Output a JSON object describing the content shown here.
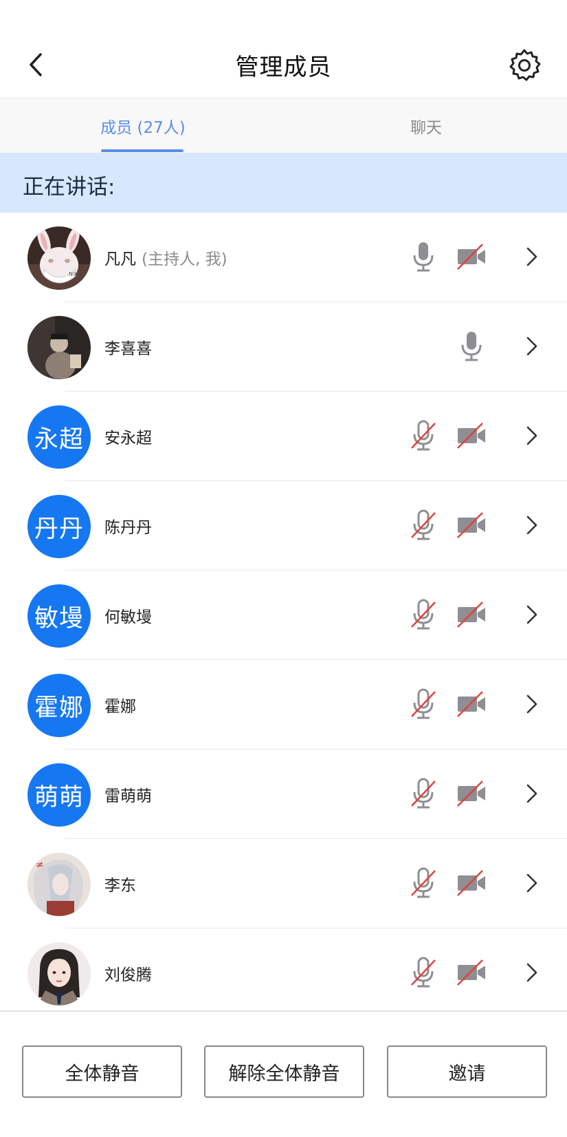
{
  "header": {
    "title": "管理成员",
    "back_icon": "chevron-left-icon",
    "settings_icon": "gear-icon"
  },
  "tabs": [
    {
      "label": "成员 (27人)",
      "selected": true
    },
    {
      "label": "聊天",
      "selected": false
    }
  ],
  "speaking_label": "正在讲话:",
  "members": [
    {
      "name": "凡凡",
      "role": "(主持人, 我)",
      "avatar": "photo-rabbit",
      "mic": "on",
      "camera": "off"
    },
    {
      "name": "李喜喜",
      "role": "",
      "avatar": "photo-dark",
      "mic": "on",
      "camera": "none"
    },
    {
      "name": "安永超",
      "role": "",
      "avatar_text": "永超",
      "mic": "off",
      "camera": "off"
    },
    {
      "name": "陈丹丹",
      "role": "",
      "avatar_text": "丹丹",
      "mic": "off",
      "camera": "off"
    },
    {
      "name": "何敏墁",
      "role": "",
      "avatar_text": "敏墁",
      "mic": "off",
      "camera": "off"
    },
    {
      "name": "霍娜",
      "role": "",
      "avatar_text": "霍娜",
      "mic": "off",
      "camera": "off"
    },
    {
      "name": "雷萌萌",
      "role": "",
      "avatar_text": "萌萌",
      "mic": "off",
      "camera": "off"
    },
    {
      "name": "李东",
      "role": "",
      "avatar": "photo-anime",
      "mic": "off",
      "camera": "off"
    },
    {
      "name": "刘俊腾",
      "role": "",
      "avatar": "photo-girl",
      "mic": "off",
      "camera": "off"
    }
  ],
  "buttons": {
    "mute_all": "全体静音",
    "unmute_all": "解除全体静音",
    "invite": "邀请"
  },
  "colors": {
    "accent": "#1677f2",
    "tab_active": "#5b8de8",
    "banner": "#d7e8fc",
    "muted_slash": "#e0433a"
  }
}
